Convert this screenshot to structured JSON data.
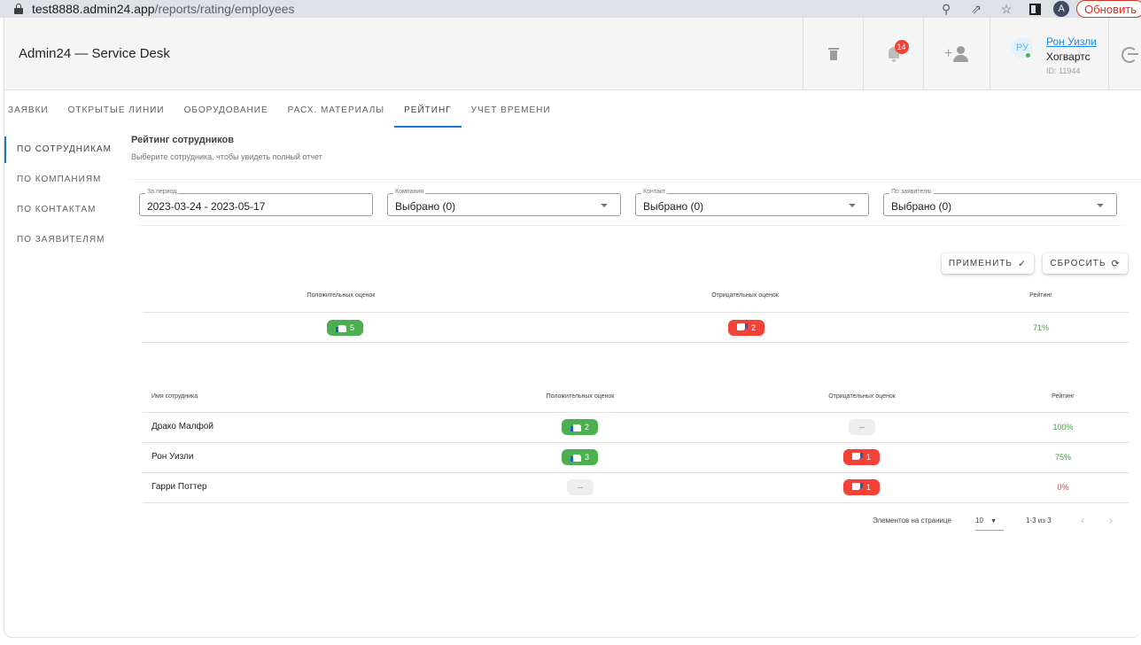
{
  "browser": {
    "url_host": "test8888.admin24.app",
    "url_path": "/reports/rating/employees",
    "profile_initial": "A",
    "refresh_label": "Обновить",
    "icons": [
      "lock-icon",
      "zoom-icon",
      "share-icon",
      "star-icon",
      "side-panel-icon"
    ]
  },
  "header": {
    "title": "Admin24 — Service Desk",
    "notifications_count": "14",
    "user": {
      "avatar_initials": "РУ",
      "name": "Рон Уизли",
      "org": "Хогвартс",
      "id_label": "ID: 11944"
    }
  },
  "tabs": [
    {
      "label": "ЗАЯВКИ"
    },
    {
      "label": "ОТКРЫТЫЕ ЛИНИИ"
    },
    {
      "label": "ОБОРУДОВАНИЕ"
    },
    {
      "label": "РАСХ. МАТЕРИАЛЫ"
    },
    {
      "label": "РЕЙТИНГ",
      "active": true
    },
    {
      "label": "УЧЕТ ВРЕМЕНИ"
    }
  ],
  "sidebar": {
    "items": [
      {
        "label": "ПО СОТРУДНИКАМ",
        "active": true
      },
      {
        "label": "ПО КОМПАНИЯМ"
      },
      {
        "label": "ПО КОНТАКТАМ"
      },
      {
        "label": "ПО ЗАЯВИТЕЛЯМ"
      }
    ]
  },
  "page": {
    "title": "Рейтинг сотрудников",
    "subtitle": "Выберите сотрудника, чтобы увидеть полный отчет"
  },
  "filters": {
    "period": {
      "label": "За период",
      "value": "2023-03-24 - 2023-05-17"
    },
    "company": {
      "label": "Компания",
      "value": "Выбрано (0)"
    },
    "contact": {
      "label": "Контакт",
      "value": "Выбрано (0)"
    },
    "requester": {
      "label": "По заявителю",
      "value": "Выбрано (0)"
    }
  },
  "actions": {
    "apply_label": "ПРИМЕНИТЬ",
    "reset_label": "СБРОСИТЬ"
  },
  "summary": {
    "headers": {
      "positive": "Положительных оценок",
      "negative": "Отрицательных оценок",
      "rating": "Рейтинг"
    },
    "positive": "5",
    "negative": "2",
    "rating": "71%"
  },
  "employees": {
    "headers": {
      "name": "Имя сотрудника",
      "positive": "Положительных оценок",
      "negative": "Отрицательных оценок",
      "rating": "Рейтинг"
    },
    "rows": [
      {
        "name": "Драко Малфой",
        "positive": "2",
        "negative": "--",
        "rating": "100%"
      },
      {
        "name": "Рон Уизли",
        "positive": "3",
        "negative": "1",
        "rating": "75%"
      },
      {
        "name": "Гарри Поттер",
        "positive": "--",
        "negative": "1",
        "rating": "0%"
      }
    ]
  },
  "pagination": {
    "per_page_label": "Элементов на странице",
    "per_page_value": "10",
    "range_label": "1-3 из 3"
  },
  "colors": {
    "accent": "#1976d2",
    "positive": "#4caf50",
    "negative": "#f44336",
    "rating_good": "#43a047",
    "rating_bad": "#e53935"
  }
}
